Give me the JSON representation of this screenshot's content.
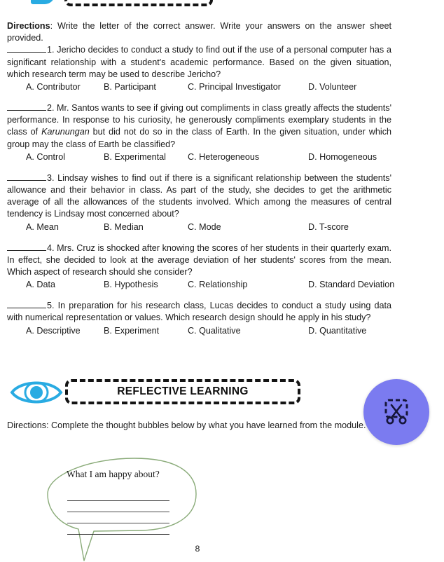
{
  "document": {
    "page_number": "8",
    "background_color": "#ffffff",
    "text_color": "#1a1a1a"
  },
  "top_header": {
    "icon_name": "cut-off-banner-icon",
    "icon_color": "#29abe2",
    "border_style": "dashed"
  },
  "assessment": {
    "directions_label": "Directions",
    "directions_text": ": Write the letter of the correct answer. Write your answers on the answer sheet provided.",
    "questions": [
      {
        "number": "1.",
        "text": " Jericho decides to conduct a study to find out if the use of a personal computer has a significant relationship with a student's academic performance. Based on the given situation, which research term may be used to describe Jericho?",
        "choices": {
          "a": "A.  Contributor",
          "b": "B. Participant",
          "c": "C. Principal Investigator",
          "d": "D. Volunteer"
        }
      },
      {
        "number": "2.",
        "text_before_italic": " Mr. Santos wants to see if giving out compliments in class greatly affects the students' performance. In response to his curiosity, he generously compliments exemplary students in the class of ",
        "italic_word": "Karunungan",
        "text_after_italic": " but did not do so in the class of Earth. In the given situation, under which group may the class of Earth be classified?",
        "choices": {
          "a": "A.  Control",
          "b": "B. Experimental",
          "c": "C. Heterogeneous",
          "d": "D. Homogeneous"
        }
      },
      {
        "number": "3.",
        "text": " Lindsay wishes to find out if there is a significant relationship between the students' allowance and their behavior in class. As part of the study, she decides to get the arithmetic average of all the allowances of the students involved. Which among the measures of central tendency is Lindsay most concerned about?",
        "choices": {
          "a": "A.  Mean",
          "b": "B. Median",
          "c": "C. Mode",
          "d": "D. T-score"
        }
      },
      {
        "number": "4.",
        "text": " Mrs. Cruz is shocked after knowing the scores of her students in their quarterly exam. In effect, she decided to look at the average deviation of her students' scores from the mean. Which aspect of research should she consider?",
        "choices": {
          "a": "A.  Data",
          "b": "B. Hypothesis",
          "c": "C. Relationship",
          "d": "D. Standard Deviation"
        }
      },
      {
        "number": "5.",
        "text": " In preparation for his research class, Lucas decides to conduct a study using data with numerical representation or values. Which research design should he apply in his study?",
        "choices": {
          "a": "A.  Descriptive",
          "b": "B. Experiment",
          "c": "C. Qualitative",
          "d": "D. Quantitative"
        }
      }
    ]
  },
  "reflective_learning": {
    "icon_name": "eye-icon",
    "icon_color": "#29abe2",
    "banner_label": "REFLECTIVE LEARNING",
    "directions": "Directions: Complete the thought bubbles below by what you have learned from the module.",
    "bubble": {
      "prompt": "What I am happy about?",
      "answer_line_count": 4,
      "outline_color": "#8aab79"
    }
  },
  "floating_button": {
    "icon_name": "snip-crop-scissors-icon",
    "background_color": "#7b7bf0",
    "icon_color": "#16163a"
  }
}
